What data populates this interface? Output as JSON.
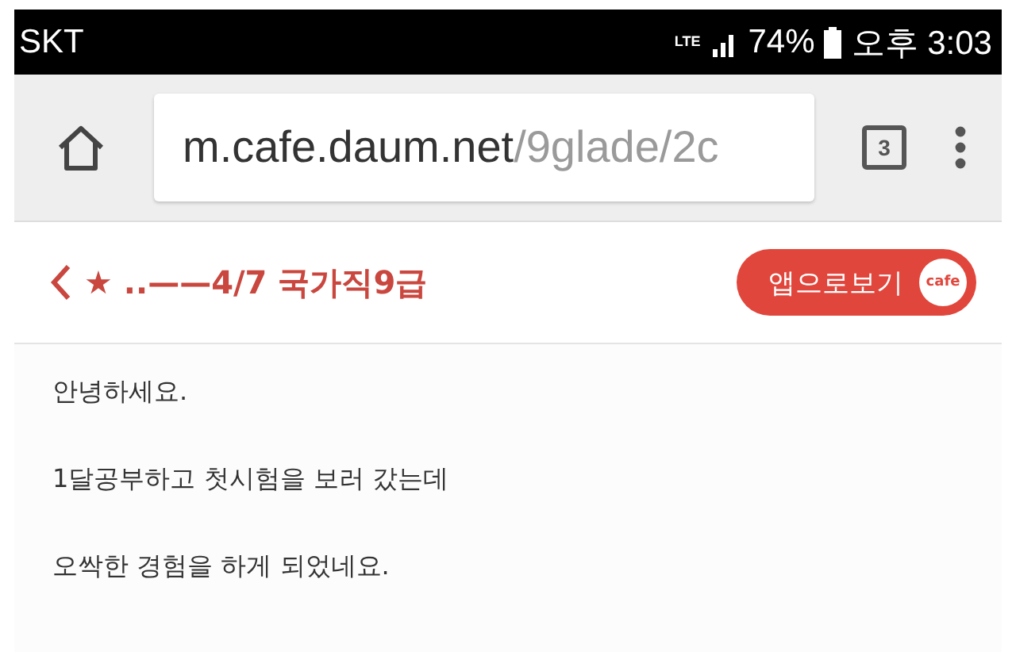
{
  "status_bar": {
    "carrier": "SKT",
    "network": "LTE",
    "battery": "74%",
    "time": "오후 3:03"
  },
  "browser_toolbar": {
    "url_host": "m.cafe.daum.net",
    "url_path": "/9glade/2c",
    "tab_count": "3"
  },
  "header": {
    "title": "★ ..——4/7 국가직9급",
    "app_button": {
      "label": "앱으로보기",
      "badge": "cafe"
    }
  },
  "post": {
    "paragraphs": [
      "안녕하세요.",
      "1달공부하고 첫시험을 보러 갔는데",
      "오싹한 경험을 하게 되었네요."
    ]
  }
}
